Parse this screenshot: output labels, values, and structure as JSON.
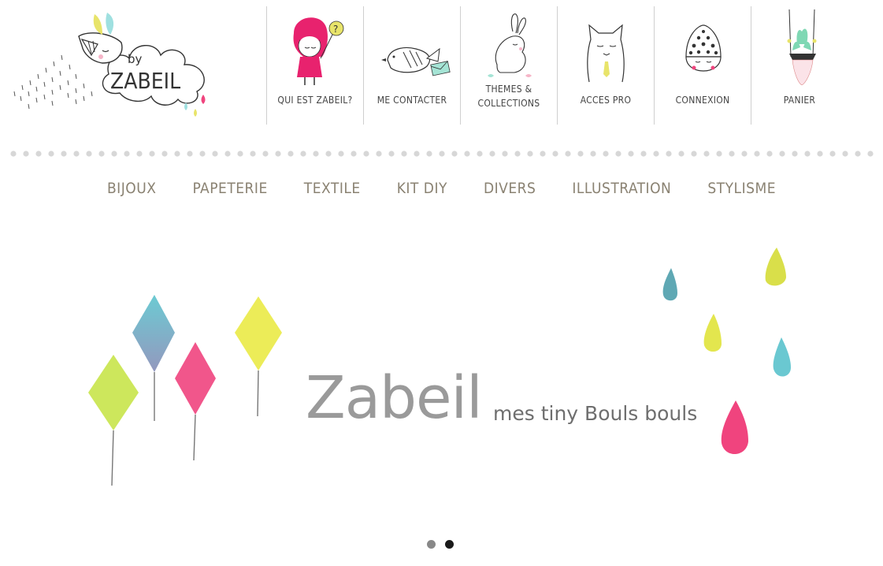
{
  "brand": {
    "logo_text_top": "by",
    "logo_text_main": "ZABEIL"
  },
  "topnav": [
    {
      "id": "about",
      "label": "QUI EST ZABEIL?",
      "icon": "red-hood-girl-icon"
    },
    {
      "id": "contact",
      "label": "ME CONTACTER",
      "icon": "bird-letter-icon"
    },
    {
      "id": "themes",
      "label_line1": "THEMES &",
      "label_line2": "COLLECTIONS",
      "icon": "rabbit-icon"
    },
    {
      "id": "pro",
      "label": "ACCES PRO",
      "icon": "cat-tie-icon"
    },
    {
      "id": "login",
      "label": "CONNEXION",
      "icon": "dotted-hat-face-icon"
    },
    {
      "id": "cart",
      "label": "PANIER",
      "icon": "hanging-plant-icon"
    }
  ],
  "categories": [
    "BIJOUX",
    "PAPETERIE",
    "TEXTILE",
    "KIT DIY",
    "DIVERS",
    "ILLUSTRATION",
    "STYLISME"
  ],
  "slider": {
    "title": "Zabeil",
    "tagline": "mes tiny Bouls bouls",
    "slide_count": 2,
    "active_slide": 2
  },
  "colors": {
    "pink": "#f0447e",
    "yellow": "#e6e84a",
    "turquoise": "#6ac8d1",
    "lime": "#c9e54e",
    "category_text": "#8a8272",
    "dot_gray": "#d7d7d7",
    "pager_inactive": "#888888",
    "pager_active": "#1a1a1a"
  }
}
